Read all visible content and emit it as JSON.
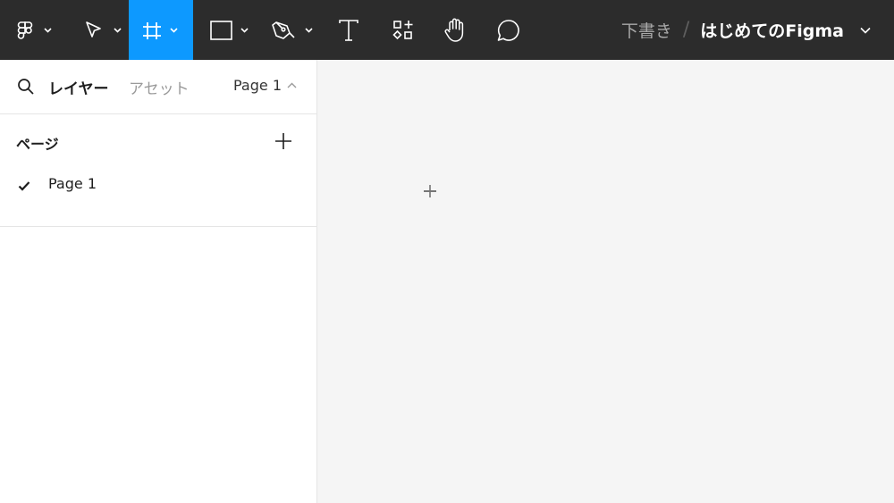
{
  "toolbar": {
    "tools": [
      {
        "name": "main-menu",
        "icon": "figma-logo-icon"
      },
      {
        "name": "move-tool",
        "icon": "pointer-icon"
      },
      {
        "name": "frame-tool",
        "icon": "frame-hash-icon",
        "active": true
      },
      {
        "name": "shape-tool",
        "icon": "rectangle-icon"
      },
      {
        "name": "pen-tool",
        "icon": "pen-icon"
      },
      {
        "name": "text-tool",
        "icon": "text-t-icon"
      },
      {
        "name": "resources-tool",
        "icon": "resources-icon"
      },
      {
        "name": "hand-tool",
        "icon": "hand-icon"
      },
      {
        "name": "comment-tool",
        "icon": "comment-icon"
      }
    ],
    "breadcrumb": {
      "draft": "下書き",
      "separator": "/",
      "file_name": "はじめてのFigma"
    },
    "active_color": "#0d99ff",
    "bg_color": "#2c2c2c"
  },
  "left_panel": {
    "tabs": {
      "layers": "レイヤー",
      "assets": "アセット"
    },
    "page_selector": "Page 1",
    "pages": {
      "title": "ページ",
      "items": [
        {
          "label": "Page 1",
          "selected": true
        }
      ]
    }
  }
}
